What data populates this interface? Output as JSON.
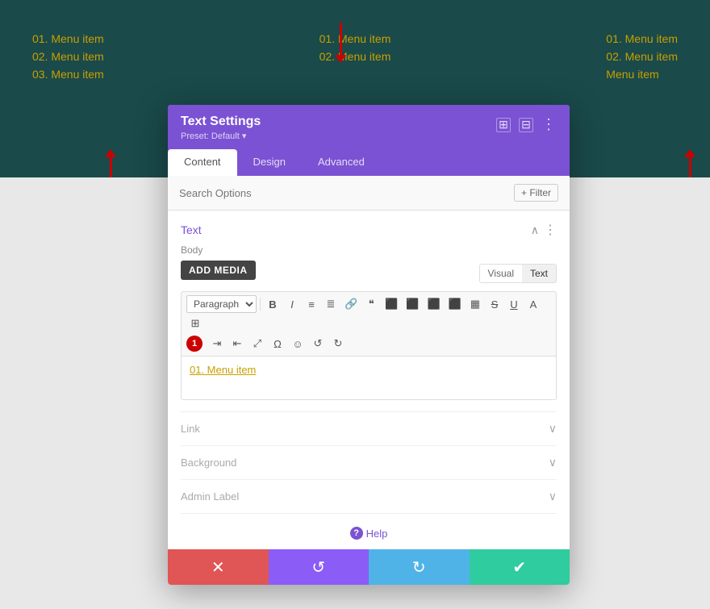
{
  "canvas": {
    "menu_columns": [
      {
        "items": [
          "01. Menu item",
          "02. Menu item",
          "03. Menu item"
        ]
      },
      {
        "items": [
          "01. Menu item",
          "02. Menu item"
        ]
      },
      {
        "items": [
          "01. Menu item",
          "02. Menu item",
          "Menu item"
        ]
      }
    ]
  },
  "modal": {
    "title": "Text Settings",
    "preset": "Preset: Default ▾",
    "header_icons": [
      "⊞",
      "⊟",
      "⋮"
    ],
    "tabs": [
      "Content",
      "Design",
      "Advanced"
    ],
    "active_tab": "Content",
    "search_placeholder": "Search Options",
    "filter_label": "+ Filter",
    "sections": {
      "text": {
        "title": "Text",
        "body_label": "Body",
        "add_media_label": "ADD MEDIA",
        "visual_label": "Visual",
        "text_label": "Text",
        "paragraph_option": "Paragraph",
        "editor_content": "01. Menu item"
      },
      "link": {
        "title": "Link"
      },
      "background": {
        "title": "Background"
      },
      "admin_label": {
        "title": "Admin Label"
      }
    },
    "help_label": "Help",
    "footer": {
      "cancel_icon": "✕",
      "undo_icon": "↺",
      "redo_icon": "↻",
      "save_icon": "✔"
    }
  }
}
